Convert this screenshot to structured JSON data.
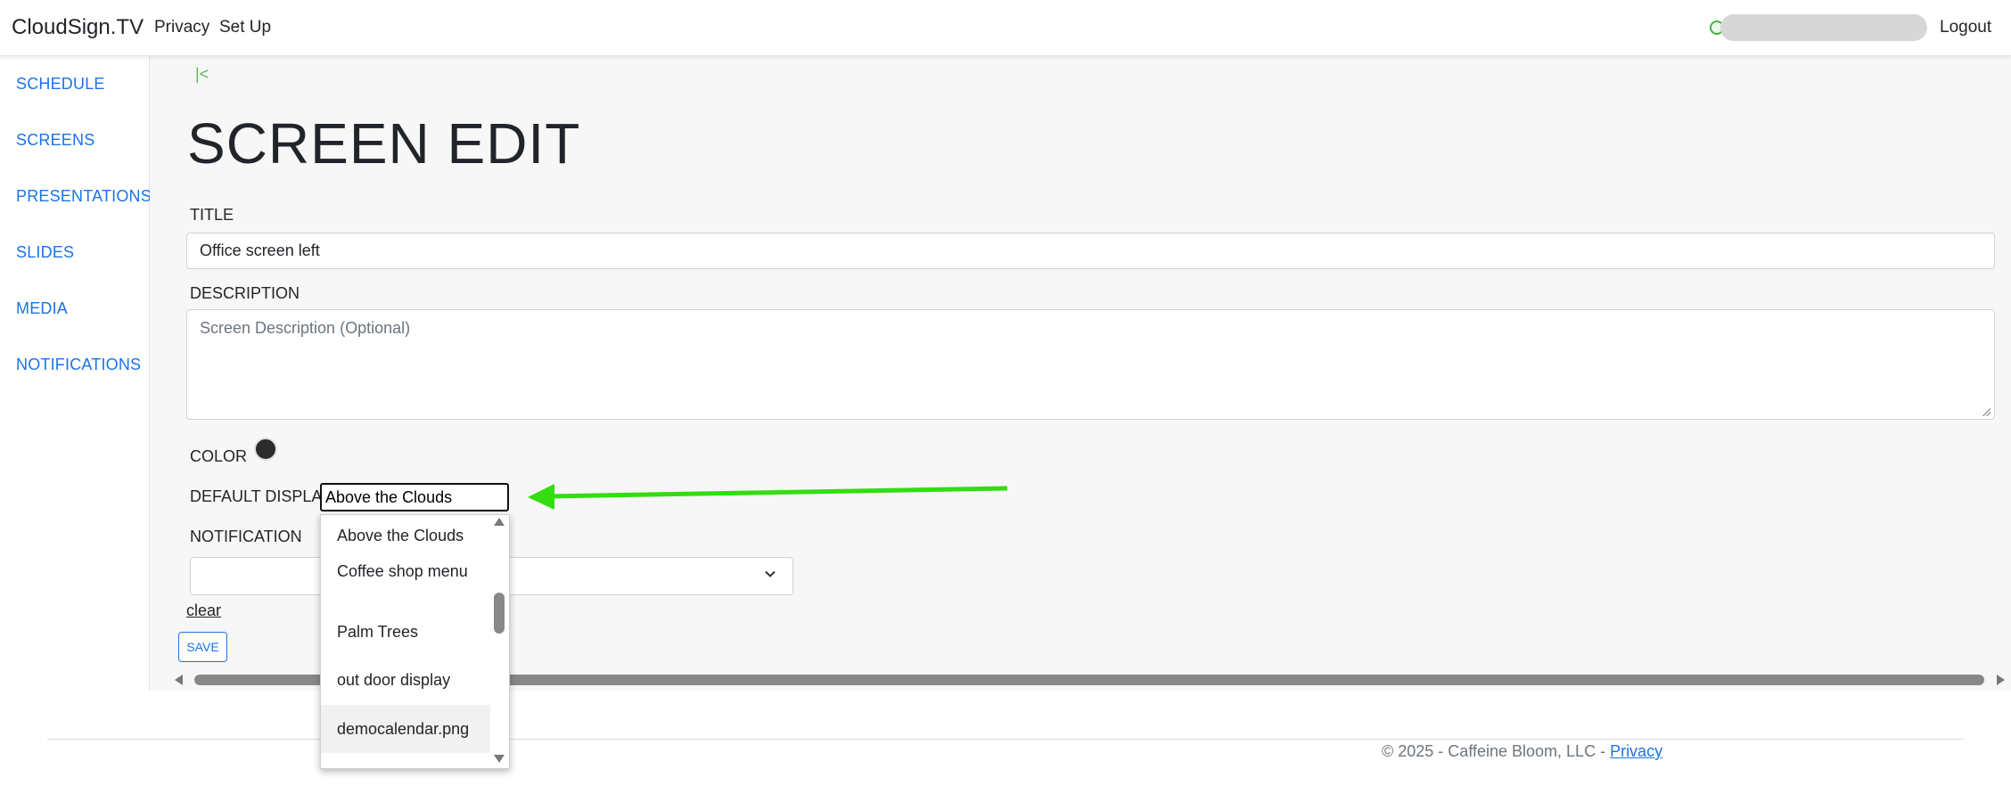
{
  "app": {
    "brand": "CloudSign.TV",
    "nav": [
      "Privacy",
      "Set Up"
    ],
    "logout_label": "Logout"
  },
  "sidebar": {
    "items": [
      {
        "label": "SCHEDULE"
      },
      {
        "label": "SCREENS"
      },
      {
        "label": "PRESENTATIONS"
      },
      {
        "label": "SLIDES"
      },
      {
        "label": "MEDIA"
      },
      {
        "label": "NOTIFICATIONS"
      }
    ]
  },
  "page": {
    "back_glyph": "|<",
    "title": "SCREEN EDIT"
  },
  "form": {
    "title_label": "TITLE",
    "title_value": "Office screen left",
    "description_label": "DESCRIPTION",
    "description_placeholder": "Screen Description (Optional)",
    "color_label": "COLOR",
    "color_value": "#2b2b2b",
    "default_display_label": "DEFAULT DISPLAY",
    "default_display_value": "Above the Clouds",
    "notification_label": "NOTIFICATION",
    "notification_value": "",
    "clear_label": "clear",
    "save_label": "SAVE"
  },
  "dropdown": {
    "options": [
      {
        "label": "Above the Clouds"
      },
      {
        "label": "Coffee shop menu"
      },
      {
        "label": "Palm Trees"
      },
      {
        "label": "out door display"
      },
      {
        "label": "democalendar.png"
      }
    ],
    "hovered": "democalendar.png"
  },
  "footer": {
    "copyright": "© 2025 - Caffeine Bloom, LLC - ",
    "privacy_link": "Privacy"
  },
  "colors": {
    "accent": "#1a73e8",
    "annotation_arrow": "#33dd11",
    "back_link": "#5cb85c"
  }
}
